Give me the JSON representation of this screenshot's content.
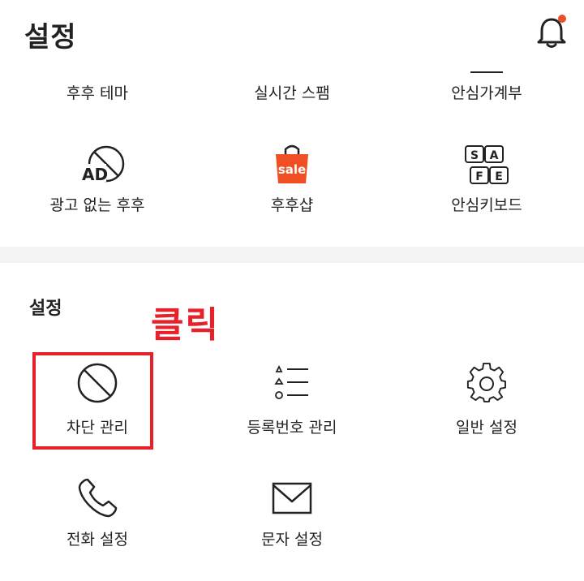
{
  "header": {
    "title": "설정",
    "notification_dot_color": "#e8502a"
  },
  "top_grid": {
    "row1": [
      {
        "label": "후후 테마"
      },
      {
        "label": "실시간 스팸"
      },
      {
        "label": "안심가계부"
      }
    ],
    "row2": [
      {
        "label": "광고 없는 후후",
        "icon": "no-ads-icon",
        "icon_text": "AD"
      },
      {
        "label": "후후샵",
        "icon": "shopping-bag-icon",
        "icon_text": "sale",
        "icon_color": "#f04e23"
      },
      {
        "label": "안심키보드",
        "icon": "keyboard-icon",
        "keys": [
          "S",
          "A",
          "F",
          "E"
        ]
      }
    ]
  },
  "settings_section": {
    "title": "설정",
    "items": [
      {
        "label": "차단 관리",
        "icon": "block-icon"
      },
      {
        "label": "등록번호 관리",
        "icon": "list-icon"
      },
      {
        "label": "일반 설정",
        "icon": "gear-icon"
      },
      {
        "label": "전화 설정",
        "icon": "phone-icon"
      },
      {
        "label": "문자 설정",
        "icon": "mail-icon"
      }
    ]
  },
  "annotation": {
    "text": "클릭",
    "color": "#e8202a"
  }
}
